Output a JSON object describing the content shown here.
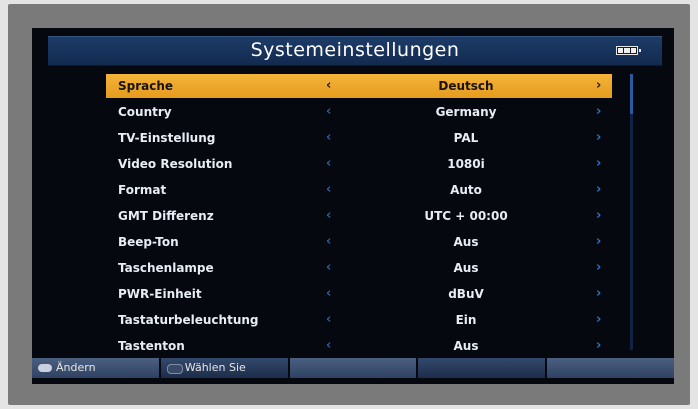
{
  "header": {
    "title": "Systemeinstellungen",
    "battery_icon": "battery-icon"
  },
  "menu": {
    "arrow_left": "‹",
    "arrow_right": "›",
    "items": [
      {
        "label": "Sprache",
        "value": "Deutsch",
        "selected": true
      },
      {
        "label": "Country",
        "value": "Germany"
      },
      {
        "label": "TV-Einstellung",
        "value": "PAL"
      },
      {
        "label": "Video Resolution",
        "value": "1080i"
      },
      {
        "label": "Format",
        "value": "Auto"
      },
      {
        "label": "GMT Differenz",
        "value": "UTC + 00:00"
      },
      {
        "label": "Beep-Ton",
        "value": "Aus"
      },
      {
        "label": "Taschenlampe",
        "value": "Aus"
      },
      {
        "label": "PWR-Einheit",
        "value": "dBuV"
      },
      {
        "label": "Tastaturbeleuchtung",
        "value": "Ein"
      },
      {
        "label": "Tastenton",
        "value": "Aus"
      }
    ]
  },
  "footer": {
    "change_label": "Ändern",
    "select_label": "Wählen Sie"
  },
  "colors": {
    "selected_row": "#f0a928",
    "title_bar": "#1a365f",
    "screen_bg": "#05080f"
  }
}
